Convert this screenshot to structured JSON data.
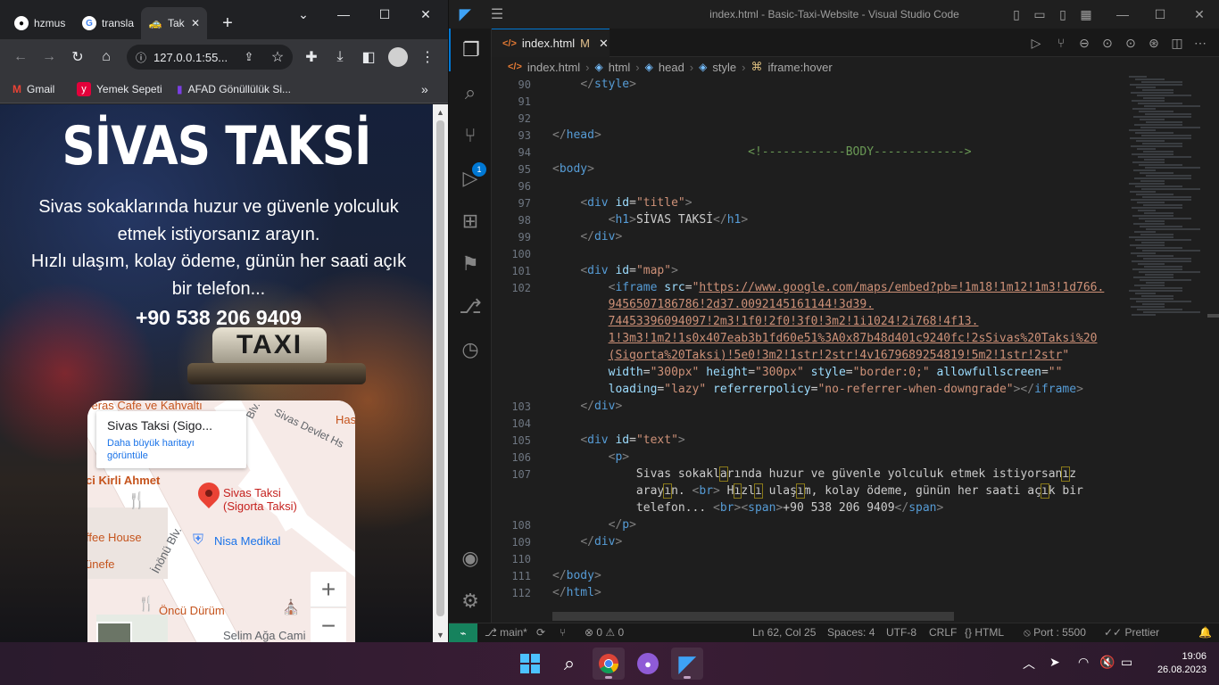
{
  "chrome": {
    "tabs": [
      {
        "label": "hzmus"
      },
      {
        "label": "transla"
      },
      {
        "label": "Tak"
      }
    ],
    "new_tab_label": "+",
    "address": "127.0.0.1:55...",
    "bookmarks": [
      {
        "label": "Gmail"
      },
      {
        "label": "Yemek Sepeti"
      },
      {
        "label": "AFAD Gönüllülük Si..."
      }
    ],
    "bookmarks_more": "»"
  },
  "page": {
    "title": "SİVAS TAKSİ",
    "text_line1": "Sivas sokaklarında huzur ve güvenle yolculuk etmek istiyorsanız arayın.",
    "text_line2": "Hızlı ulaşım, kolay ödeme, günün her saati açık bir telefon...",
    "phone": "+90 538 206 9409",
    "taxi_sign": "TAXI",
    "map": {
      "place_name": "Sivas Taksi (Sigo...",
      "larger_map_link": "Daha büyük haritayı görüntüle",
      "pin_label": "Sivas Taksi (Sigorta Taksi)",
      "labels": [
        "Teras Cafe ve Kahvaltı",
        "Has",
        "ci Kirli Ahmet",
        "ffee House",
        "ünefe",
        "İnönü Blv.",
        "Nisa Medikal",
        "Öncü Dürüm",
        "Selim Ağa Cami",
        "Sivas Devlet Hs",
        "Blv."
      ],
      "zoom_in": "+",
      "zoom_out": "−"
    }
  },
  "vscode": {
    "window_title": "index.html - Basic-Taxi-Website - Visual Studio Code",
    "tab_label": "index.html",
    "tab_status": "M",
    "breadcrumbs": [
      "index.html",
      "html",
      "head",
      "style",
      "iframe:hover"
    ],
    "scm_badge": "1",
    "code_lines": [
      {
        "n": "90",
        "html": "    <span class='br'>&lt;/</span><span class='t'>style</span><span class='br'>&gt;</span>"
      },
      {
        "n": "91",
        "html": ""
      },
      {
        "n": "92",
        "html": ""
      },
      {
        "n": "93",
        "html": "<span class='br'>&lt;/</span><span class='t'>head</span><span class='br'>&gt;</span>"
      },
      {
        "n": "94",
        "html": "                            <span class='c'>&lt;!------------BODY-------------&gt;</span>"
      },
      {
        "n": "95",
        "html": "<span class='br'>&lt;</span><span class='t'>body</span><span class='br'>&gt;</span>"
      },
      {
        "n": "96",
        "html": ""
      },
      {
        "n": "97",
        "html": "    <span class='br'>&lt;</span><span class='t'>div</span> <span class='a'>id</span>=<span class='s'>\"title\"</span><span class='br'>&gt;</span>"
      },
      {
        "n": "98",
        "html": "        <span class='br'>&lt;</span><span class='t'>h1</span><span class='br'>&gt;</span><span class='txt'>SİVAS TAKSİ</span><span class='br'>&lt;/</span><span class='t'>h1</span><span class='br'>&gt;</span>"
      },
      {
        "n": "99",
        "html": "    <span class='br'>&lt;/</span><span class='t'>div</span><span class='br'>&gt;</span>"
      },
      {
        "n": "100",
        "html": ""
      },
      {
        "n": "101",
        "html": "    <span class='br'>&lt;</span><span class='t'>div</span> <span class='a'>id</span>=<span class='s'>\"map\"</span><span class='br'>&gt;</span>"
      },
      {
        "n": "102",
        "html": "        <span class='br'>&lt;</span><span class='t'>iframe</span> <span class='a'>src</span>=<span class='s'>\"</span><span class='url'>https://www.google.com/maps/embed?pb=!1m18!1m12!1m3!1d766.</span>"
      },
      {
        "n": "",
        "html": "        <span class='url'>9456507186786!2d37.0092145161144!3d39.</span>"
      },
      {
        "n": "",
        "html": "        <span class='url'>7445339609409​7!2m3!1f0!2f0!3f0!3m2!1i1024!2i768!4f13.</span>"
      },
      {
        "n": "",
        "html": "        <span class='url'>1!3m3!1m2!1s0x407eab3b1fd60e51%3A0x87b48d401c9240fc!2sSivas%20Taksi%20</span>"
      },
      {
        "n": "",
        "html": "        <span class='url'>(Sigorta%20Taksi)!5e0!3m2!1str!2str!4v1679689254819!5m2!1str!2str</span><span class='s'>\"</span>"
      },
      {
        "n": "",
        "html": "        <span class='a'>width</span>=<span class='s'>\"300px\"</span> <span class='a'>height</span>=<span class='s'>\"300px\"</span> <span class='a'>style</span>=<span class='s'>\"border:0;\"</span> <span class='a'>allowfullscreen</span>=<span class='s'>\"\"</span>"
      },
      {
        "n": "",
        "html": "        <span class='a'>loading</span>=<span class='s'>\"lazy\"</span> <span class='a'>referrerpolicy</span>=<span class='s'>\"no-referrer-when-downgrade\"</span><span class='br'>&gt;&lt;/</span><span class='t'>iframe</span><span class='br'>&gt;</span>"
      },
      {
        "n": "103",
        "html": "    <span class='br'>&lt;/</span><span class='t'>div</span><span class='br'>&gt;</span>"
      },
      {
        "n": "104",
        "html": ""
      },
      {
        "n": "105",
        "html": "    <span class='br'>&lt;</span><span class='t'>div</span> <span class='a'>id</span>=<span class='s'>\"text\"</span><span class='br'>&gt;</span>"
      },
      {
        "n": "106",
        "html": "        <span class='br'>&lt;</span><span class='t'>p</span><span class='br'>&gt;</span>"
      },
      {
        "n": "107",
        "html": "            <span class='txt'>Sivas sokakl<span class='cur'>a</span>rında huzur ve güvenle yolculuk etmek istiyorsan<span class='cur'>ı</span>z</span>"
      },
      {
        "n": "",
        "html": "            <span class='txt'>aray<span class='cur'>ı</span>n. </span><span class='br'>&lt;</span><span class='t'>br</span><span class='br'>&gt;</span><span class='txt'> H<span class='cur'>ı</span>zl<span class='cur'>ı</span> ulaş<span class='cur'>ı</span>m, kolay ödeme, günün her saati aç<span class='cur'>ı</span>k bir</span>"
      },
      {
        "n": "",
        "html": "            <span class='txt'>telefon... </span><span class='br'>&lt;</span><span class='t'>br</span><span class='br'>&gt;&lt;</span><span class='t'>span</span><span class='br'>&gt;</span><span class='txt'>+90 538 206 9409</span><span class='br'>&lt;/</span><span class='t'>span</span><span class='br'>&gt;</span>"
      },
      {
        "n": "108",
        "html": "        <span class='br'>&lt;/</span><span class='t'>p</span><span class='br'>&gt;</span>"
      },
      {
        "n": "109",
        "html": "    <span class='br'>&lt;/</span><span class='t'>div</span><span class='br'>&gt;</span>"
      },
      {
        "n": "110",
        "html": ""
      },
      {
        "n": "111",
        "html": "<span class='br'>&lt;/</span><span class='t'>body</span><span class='br'>&gt;</span>"
      },
      {
        "n": "112",
        "html": "<span class='br'>&lt;/</span><span class='t'>html</span><span class='br'>&gt;</span>"
      }
    ],
    "status": {
      "branch": "main*",
      "errors": "0",
      "warnings": "0",
      "position": "Ln 62, Col 25",
      "spaces": "Spaces: 4",
      "encoding": "UTF-8",
      "eol": "CRLF",
      "language": "HTML",
      "port": "Port : 5500",
      "formatter": "Prettier"
    }
  },
  "taskbar": {
    "time": "19:06",
    "date": "26.08.2023"
  },
  "colors": {
    "vscode_accent": "#0078d4",
    "remote_indicator": "#16825d",
    "map_pin": "#ea4335",
    "link": "#1a73e8"
  }
}
